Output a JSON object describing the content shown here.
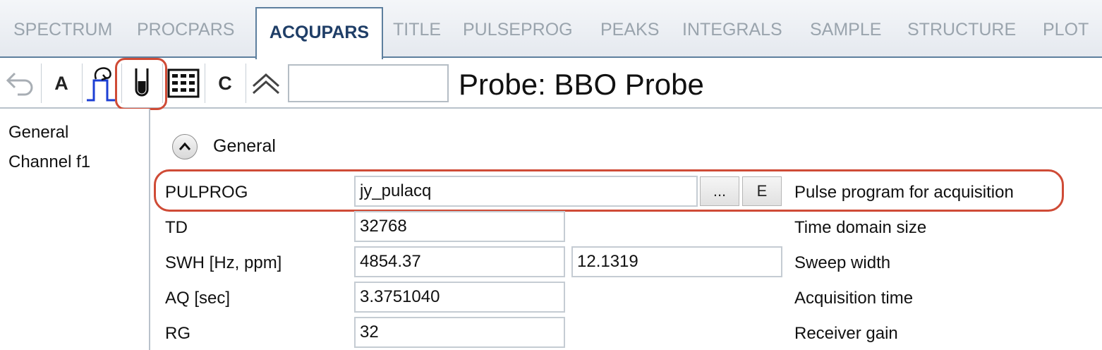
{
  "tabs": [
    {
      "label": "SPECTRUM",
      "active": false
    },
    {
      "label": "PROCPARS",
      "active": false
    },
    {
      "label": "ACQUPARS",
      "active": true
    },
    {
      "label": "TITLE",
      "active": false
    },
    {
      "label": "PULSEPROG",
      "active": false
    },
    {
      "label": "PEAKS",
      "active": false
    },
    {
      "label": "INTEGRALS",
      "active": false
    },
    {
      "label": "SAMPLE",
      "active": false
    },
    {
      "label": "STRUCTURE",
      "active": false
    },
    {
      "label": "PLOT",
      "active": false
    }
  ],
  "toolbar": {
    "buttons": [
      {
        "icon": "undo-arrow-icon"
      },
      {
        "label": "A"
      },
      {
        "icon": "pulse-program-icon"
      },
      {
        "icon": "probe-tube-icon",
        "highlighted": true
      },
      {
        "icon": "grid-table-icon"
      },
      {
        "label": "C"
      },
      {
        "icon": "double-chevron-up-icon"
      }
    ],
    "search_value": "",
    "probe_title": "Probe: BBO Probe"
  },
  "sidebar": {
    "items": [
      {
        "label": "General"
      },
      {
        "label": "Channel f1"
      }
    ]
  },
  "section": {
    "title": "General",
    "toggle_icon": "chevron-up-circle-icon"
  },
  "params": {
    "pulprog": {
      "label": "PULPROG",
      "value": "jy_pulacq",
      "browse_label": "...",
      "edit_label": "E",
      "description": "Pulse program for acquisition"
    },
    "td": {
      "label": "TD",
      "value": "32768",
      "description": "Time domain size"
    },
    "swh": {
      "label": "SWH [Hz, ppm]",
      "value_hz": "4854.37",
      "value_ppm": "12.1319",
      "description": "Sweep width"
    },
    "aq": {
      "label": "AQ [sec]",
      "value": "3.3751040",
      "description": "Acquisition time"
    },
    "rg": {
      "label": "RG",
      "value": "32",
      "description": "Receiver gain"
    }
  },
  "colors": {
    "highlight": "#cf4b36",
    "active_tab_text": "#1f3e67",
    "inactive_tab_text": "#9aa4ad",
    "tab_border": "#5d7f9e"
  }
}
